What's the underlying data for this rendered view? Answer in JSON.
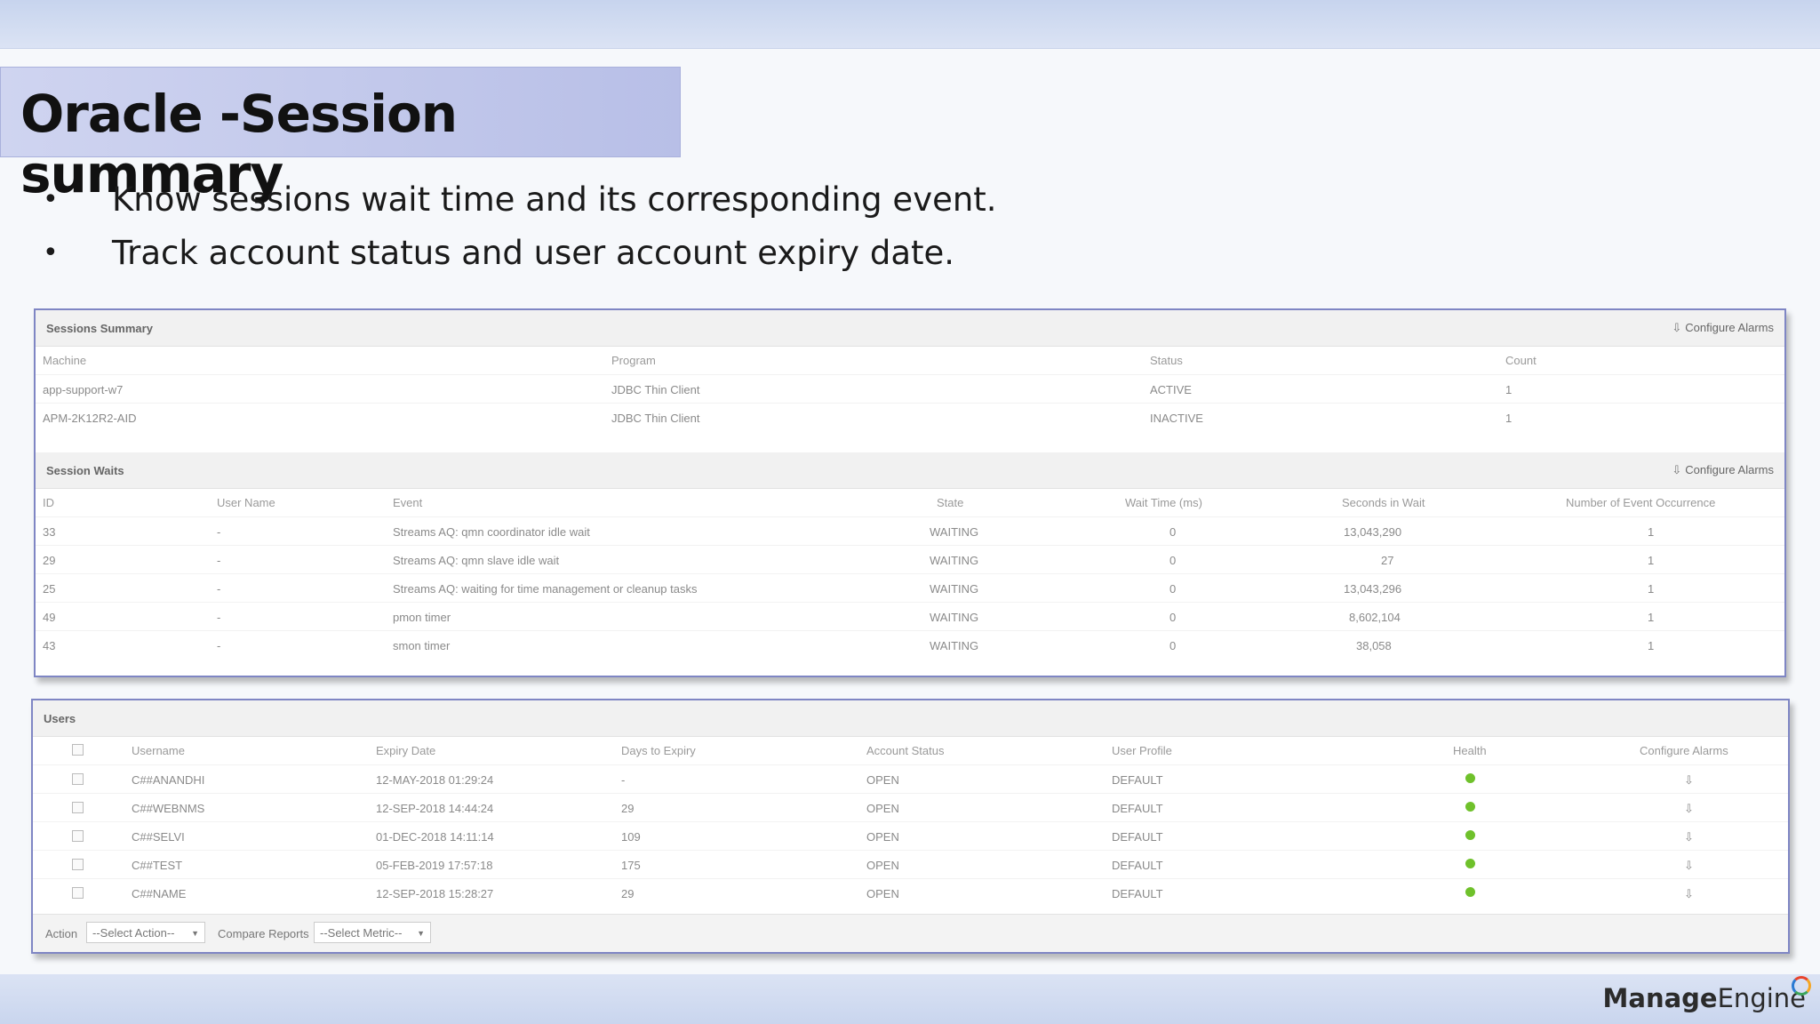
{
  "slide": {
    "title": "Oracle -Session summary",
    "bullets": [
      "Know sessions wait time and its corresponding event.",
      "Track account status and user account expiry date."
    ],
    "brand": {
      "manage": "Manage",
      "engine": "Engine"
    }
  },
  "sessions_summary": {
    "title": "Sessions Summary",
    "configure_label": "Configure Alarms",
    "columns": [
      "Machine",
      "Program",
      "Status",
      "Count"
    ],
    "rows": [
      [
        "app-support-w7",
        "JDBC Thin Client",
        "ACTIVE",
        "1"
      ],
      [
        "APM-2K12R2-AID",
        "JDBC Thin Client",
        "INACTIVE",
        "1"
      ]
    ]
  },
  "session_waits": {
    "title": "Session Waits",
    "configure_label": "Configure Alarms",
    "columns": [
      "ID",
      "User Name",
      "Event",
      "State",
      "Wait Time (ms)",
      "Seconds in Wait",
      "Number of Event Occurrence"
    ],
    "rows": [
      [
        "33",
        "-",
        "Streams AQ: qmn coordinator idle wait",
        "WAITING",
        "0",
        "13,043,290",
        "1"
      ],
      [
        "29",
        "-",
        "Streams AQ: qmn slave idle wait",
        "WAITING",
        "0",
        "27",
        "1"
      ],
      [
        "25",
        "-",
        "Streams AQ: waiting for time management or cleanup tasks",
        "WAITING",
        "0",
        "13,043,296",
        "1"
      ],
      [
        "49",
        "-",
        "pmon timer",
        "WAITING",
        "0",
        "8,602,104",
        "1"
      ],
      [
        "43",
        "-",
        "smon timer",
        "WAITING",
        "0",
        "38,058",
        "1"
      ]
    ]
  },
  "users": {
    "title": "Users",
    "columns": [
      "Username",
      "Expiry Date",
      "Days to Expiry",
      "Account Status",
      "User Profile",
      "Health",
      "Configure Alarms"
    ],
    "rows": [
      [
        "C##ANANDHI",
        "12-MAY-2018 01:29:24",
        "-",
        "OPEN",
        "DEFAULT"
      ],
      [
        "C##WEBNMS",
        "12-SEP-2018 14:44:24",
        "29",
        "OPEN",
        "DEFAULT"
      ],
      [
        "C##SELVI",
        "01-DEC-2018 14:11:14",
        "109",
        "OPEN",
        "DEFAULT"
      ],
      [
        "C##TEST",
        "05-FEB-2019 17:57:18",
        "175",
        "OPEN",
        "DEFAULT"
      ],
      [
        "C##NAME",
        "12-SEP-2018 15:28:27",
        "29",
        "OPEN",
        "DEFAULT"
      ]
    ],
    "health_color": "#6fc12b",
    "action_label": "Action",
    "action_select": "--Select Action--",
    "compare_label": "Compare Reports",
    "compare_select": "--Select Metric--"
  }
}
